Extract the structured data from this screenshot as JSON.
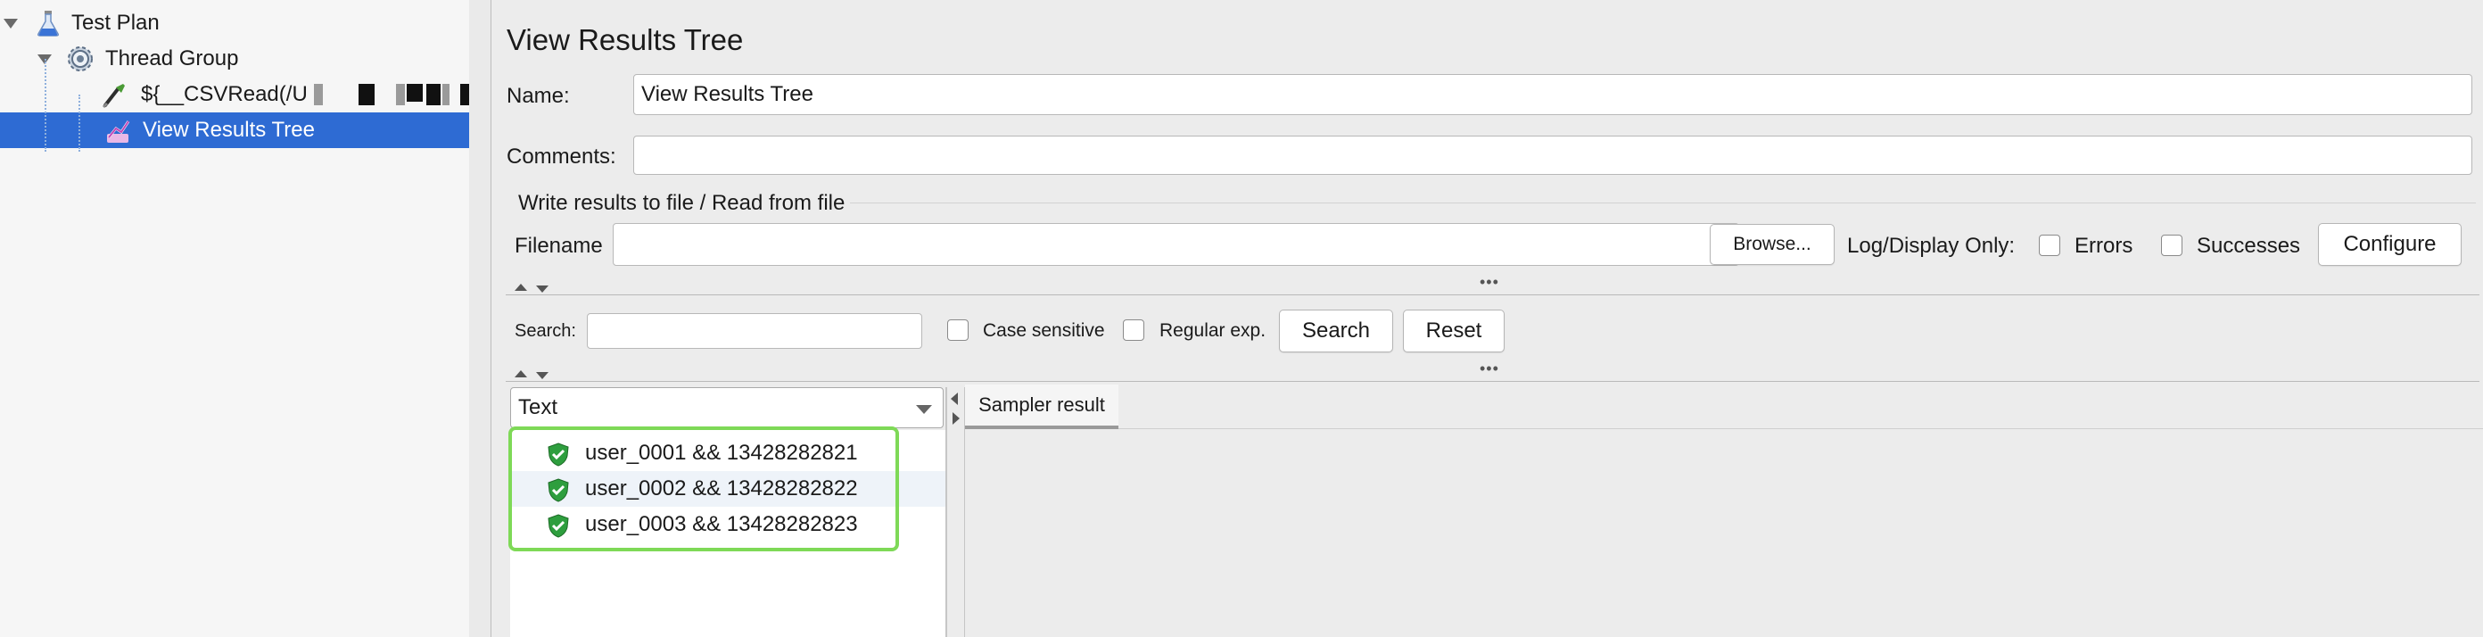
{
  "tree": {
    "items": [
      {
        "label": "Test Plan",
        "icon": "flask-icon"
      },
      {
        "label": "Thread Group",
        "icon": "gear-icon"
      },
      {
        "label": "${__CSVRead(/U",
        "icon": "sampler-icon"
      },
      {
        "label": "View Results Tree",
        "icon": "results-tree-icon"
      }
    ]
  },
  "panel": {
    "title": "View Results Tree",
    "name_label": "Name:",
    "name_value": "View Results Tree",
    "comments_label": "Comments:",
    "comments_value": "",
    "file_section_title": "Write results to file / Read from file",
    "filename_label": "Filename",
    "filename_value": "",
    "browse_button": "Browse...",
    "log_display_label": "Log/Display Only:",
    "errors_label": "Errors",
    "successes_label": "Successes",
    "configure_button": "Configure"
  },
  "search": {
    "label": "Search:",
    "value": "",
    "case_sensitive_label": "Case sensitive",
    "regular_exp_label": "Regular exp.",
    "search_button": "Search",
    "reset_button": "Reset"
  },
  "renderer": {
    "selected": "Text"
  },
  "results": [
    {
      "label": "user_0001 && 13428282821",
      "status": "success"
    },
    {
      "label": "user_0002 && 13428282822",
      "status": "success"
    },
    {
      "label": "user_0003 && 13428282823",
      "status": "success"
    }
  ],
  "detail_tabs": [
    {
      "label": "Sampler result"
    }
  ],
  "colors": {
    "selection": "#2e6bd3",
    "success_shield": "#2e9e3e",
    "highlight_box": "#7ed957"
  }
}
